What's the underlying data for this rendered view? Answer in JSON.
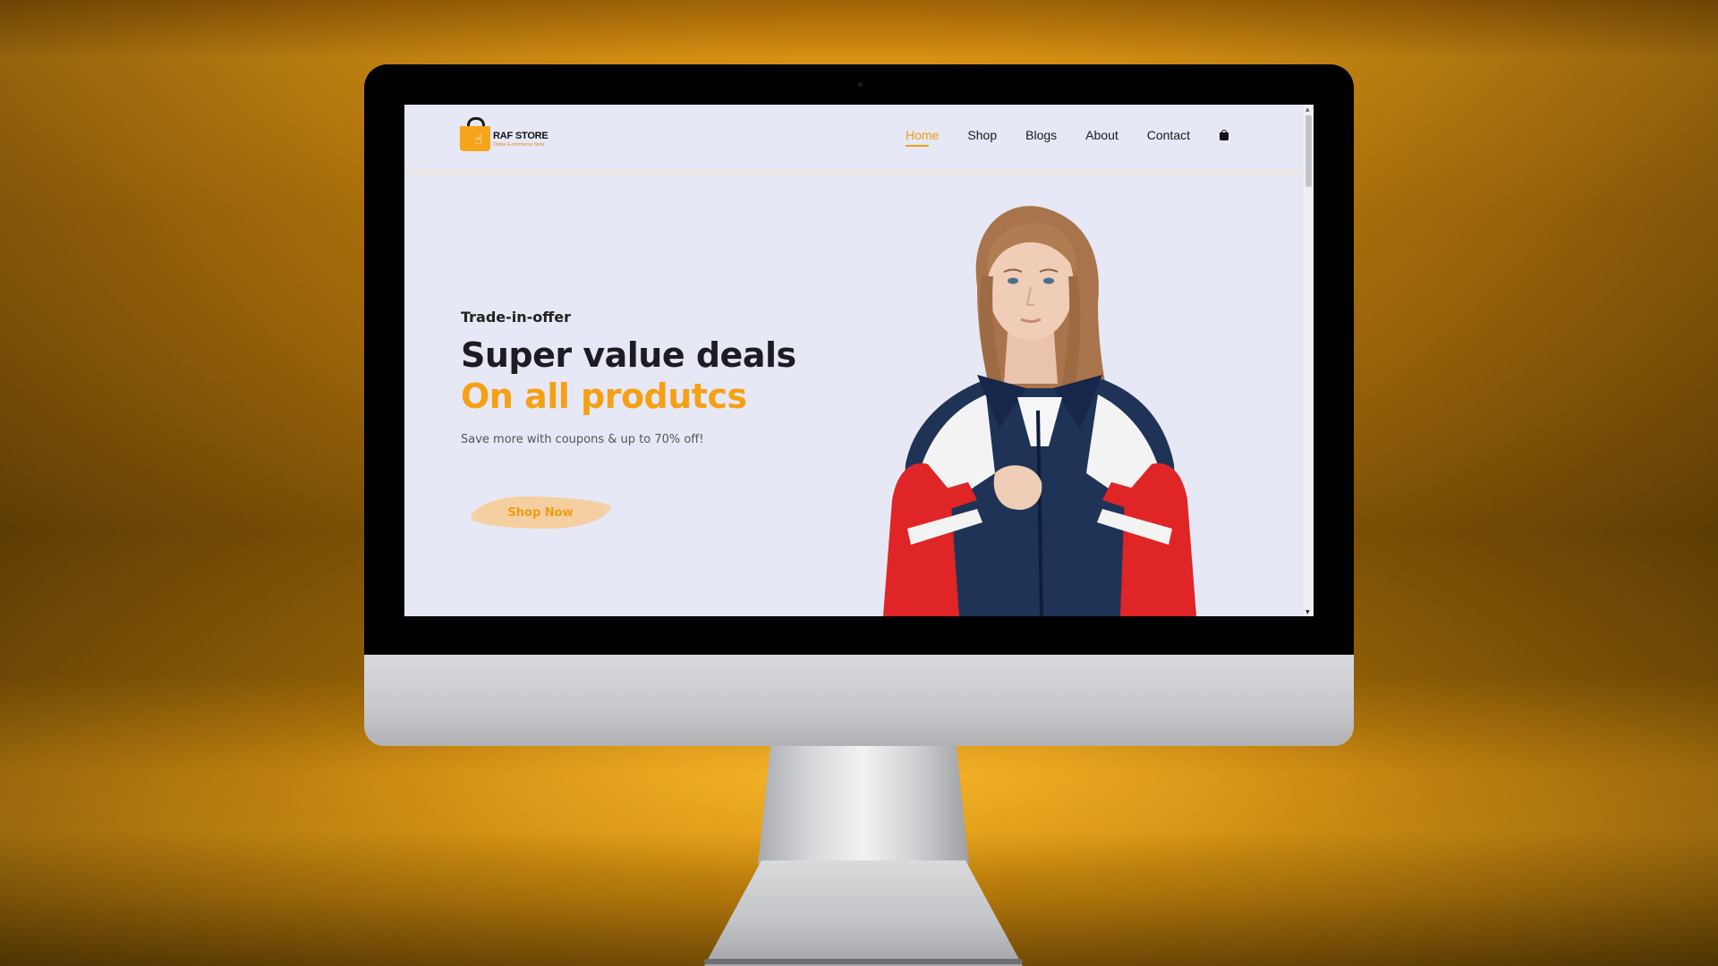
{
  "store": {
    "name": "RAF STORE",
    "tagline": "Online E-commerce Store"
  },
  "nav": {
    "items": [
      {
        "label": "Home",
        "active": true
      },
      {
        "label": "Shop",
        "active": false
      },
      {
        "label": "Blogs",
        "active": false
      },
      {
        "label": "About",
        "active": false
      },
      {
        "label": "Contact",
        "active": false
      }
    ],
    "cart_icon": "shopping-bag-icon"
  },
  "hero": {
    "kicker": "Trade-in-offer",
    "headline": "Super value deals",
    "headline_accent": "On all produtcs",
    "subtext": "Save more with coupons & up to 70% off!",
    "button_label": "Shop Now",
    "image": "model-in-red-white-navy-jacket"
  },
  "colors": {
    "accent": "#f6a014",
    "page_bg": "#e6e8f5",
    "backdrop": "#d68a0d"
  }
}
